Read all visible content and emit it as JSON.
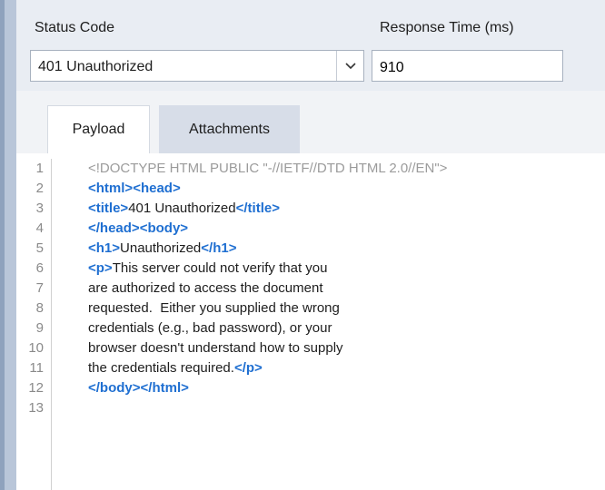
{
  "status_code": {
    "label": "Status Code",
    "selected": "401 Unauthorized",
    "arrow_glyph": "⌄"
  },
  "response_time": {
    "label": "Response Time (ms)",
    "value": "910"
  },
  "tabs": [
    {
      "label": "Payload",
      "active": true
    },
    {
      "label": "Attachments",
      "active": false
    }
  ],
  "editor": {
    "line_numbers": [
      "1",
      "2",
      "3",
      "4",
      "5",
      "6",
      "7",
      "8",
      "9",
      "10",
      "11",
      "12",
      "13"
    ],
    "lines": [
      [
        {
          "t": "<!DOCTYPE HTML PUBLIC \"-//IETF//DTD HTML 2.0//EN\">",
          "k": "doctype"
        }
      ],
      [
        {
          "t": "<html>",
          "k": "tag"
        },
        {
          "t": "<head>",
          "k": "tag"
        }
      ],
      [
        {
          "t": "<title>",
          "k": "tag"
        },
        {
          "t": "401 Unauthorized",
          "k": "text"
        },
        {
          "t": "</title>",
          "k": "tag"
        }
      ],
      [
        {
          "t": "</head>",
          "k": "tag"
        },
        {
          "t": "<body>",
          "k": "tag"
        }
      ],
      [
        {
          "t": "<h1>",
          "k": "tag"
        },
        {
          "t": "Unauthorized",
          "k": "text"
        },
        {
          "t": "</h1>",
          "k": "tag"
        }
      ],
      [
        {
          "t": "<p>",
          "k": "tag"
        },
        {
          "t": "This server could not verify that you",
          "k": "text"
        }
      ],
      [
        {
          "t": "are authorized to access the document",
          "k": "text"
        }
      ],
      [
        {
          "t": "requested.  Either you supplied the wrong",
          "k": "text"
        }
      ],
      [
        {
          "t": "credentials (e.g., bad password), or your",
          "k": "text"
        }
      ],
      [
        {
          "t": "browser doesn't understand how to supply",
          "k": "text"
        }
      ],
      [
        {
          "t": "the credentials required.",
          "k": "text"
        },
        {
          "t": "</p>",
          "k": "tag"
        }
      ],
      [
        {
          "t": "</body>",
          "k": "tag"
        },
        {
          "t": "</html>",
          "k": "tag"
        }
      ],
      []
    ]
  },
  "colors": {
    "tag": "#1f6fd1",
    "doctype": "#9b9b9b",
    "header_bg": "#e9edf3",
    "inactive_tab_bg": "#d7dde8",
    "left_strip": "#b9c6d9"
  }
}
